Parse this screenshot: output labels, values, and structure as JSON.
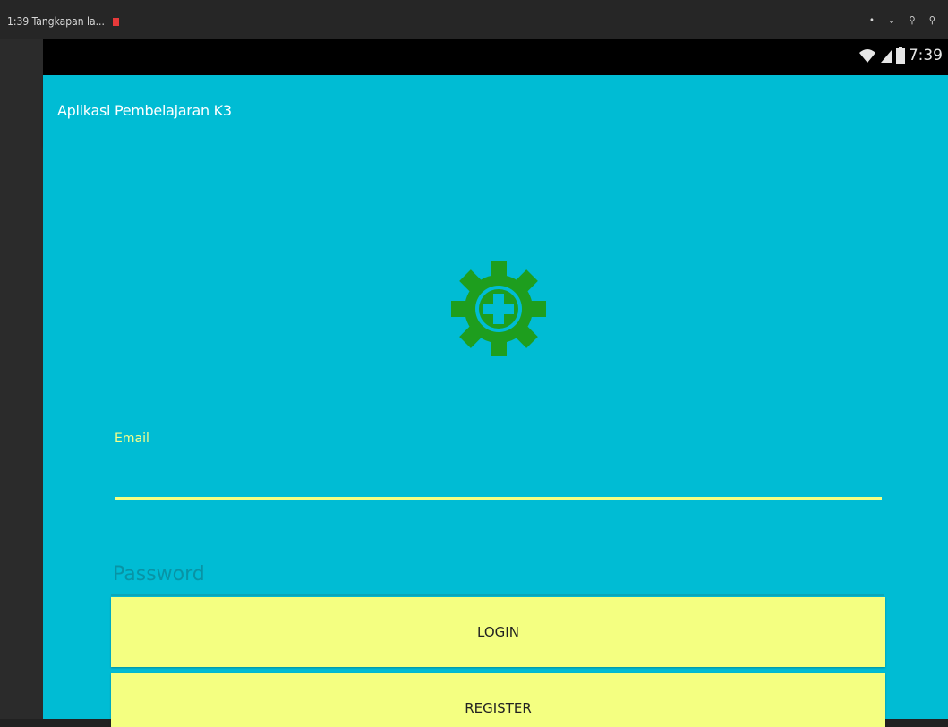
{
  "window": {
    "title": "1:39 Tangkapan la...",
    "controls": "• ⌄ ⚲ ⚲"
  },
  "status_bar": {
    "time": "7:39",
    "icons": [
      "wifi-icon",
      "signal-icon",
      "battery-icon"
    ]
  },
  "app_bar": {
    "title": "Aplikasi Pembelajaran K3"
  },
  "logo": {
    "icon": "gear-plus-icon",
    "color": "#1e9e1e"
  },
  "form": {
    "email": {
      "label": "Email",
      "value": ""
    },
    "password": {
      "placeholder": "Password",
      "value": ""
    }
  },
  "buttons": {
    "login": "LOGIN",
    "register": "REGISTER"
  },
  "colors": {
    "primary": "#00bcd4",
    "accent": "#f4ff81",
    "logo_green": "#1e9e1e"
  }
}
